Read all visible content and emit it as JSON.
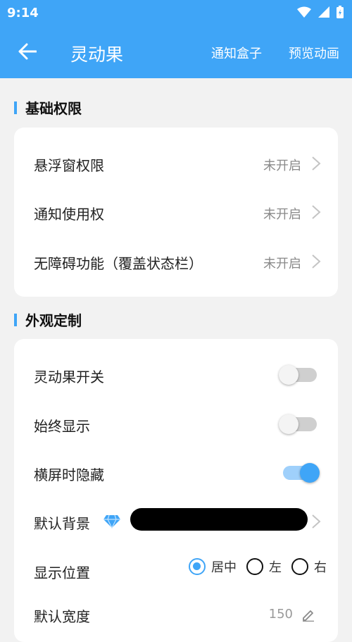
{
  "status_bar": {
    "time": "9:14"
  },
  "toolbar": {
    "title": "灵动果",
    "action1": "通知盒子",
    "action2": "预览动画"
  },
  "section_basic": {
    "title": "基础权限",
    "items": [
      {
        "label": "悬浮窗权限",
        "value": "未开启"
      },
      {
        "label": "通知使用权",
        "value": "未开启"
      },
      {
        "label": "无障碍功能（覆盖状态栏）",
        "value": "未开启"
      }
    ]
  },
  "section_appearance": {
    "title": "外观定制",
    "toggles": [
      {
        "label": "灵动果开关",
        "state": "off"
      },
      {
        "label": "始终显示",
        "state": "off"
      },
      {
        "label": "横屏时隐藏",
        "state": "on"
      }
    ],
    "default_bg_label": "默认背景",
    "position": {
      "label": "显示位置",
      "options": [
        "居中",
        "左",
        "右"
      ],
      "selected": "居中"
    },
    "width": {
      "label": "默认宽度",
      "value": "150"
    }
  },
  "colors": {
    "accent": "#3fa5f7",
    "bg": "#f2f2f2"
  }
}
